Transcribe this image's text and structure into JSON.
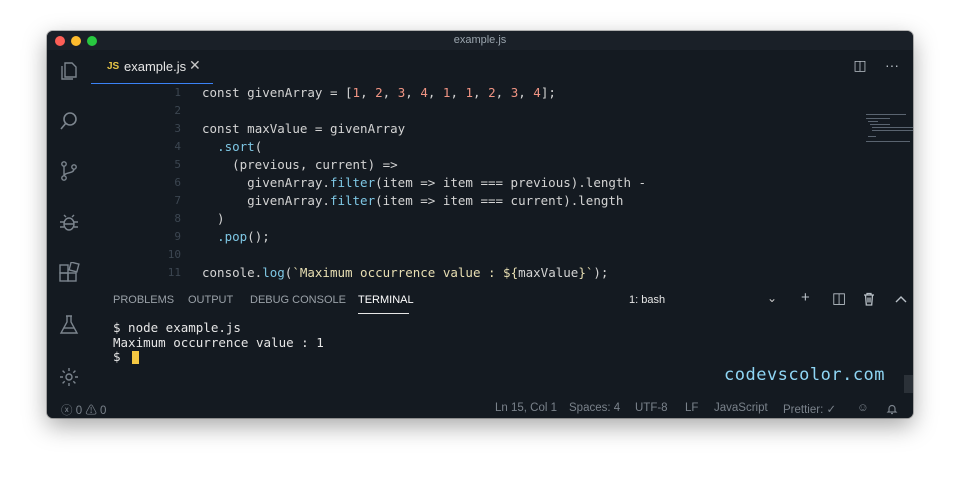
{
  "window": {
    "title": "example.js"
  },
  "tab": {
    "badge": "JS",
    "name": "example.js",
    "close": "✕"
  },
  "tab_actions": {
    "split": "◫",
    "more": "···"
  },
  "editor": {
    "lines": [
      {
        "n": "1",
        "text": "const givenArray = [1, 2, 3, 4, 1, 1, 2, 3, 4];"
      },
      {
        "n": "2",
        "text": ""
      },
      {
        "n": "3",
        "text": "const maxValue = givenArray"
      },
      {
        "n": "4",
        "text": "  .sort("
      },
      {
        "n": "5",
        "text": "    (previous, current) =>"
      },
      {
        "n": "6",
        "text": "      givenArray.filter(item => item === previous).length -"
      },
      {
        "n": "7",
        "text": "      givenArray.filter(item => item === current).length"
      },
      {
        "n": "8",
        "text": "  )"
      },
      {
        "n": "9",
        "text": "  .pop();"
      },
      {
        "n": "10",
        "text": ""
      },
      {
        "n": "11",
        "text": "console.log(`Maximum occurrence value : ${maxValue}`);"
      }
    ]
  },
  "panel": {
    "tabs": [
      "PROBLEMS",
      "OUTPUT",
      "DEBUG CONSOLE",
      "TERMINAL"
    ],
    "active_tab": "TERMINAL",
    "shell": "1: bash",
    "actions": {
      "add": "+",
      "split": "◫",
      "trash": "🗑",
      "maximize": "︿",
      "close": "✕"
    }
  },
  "terminal": {
    "lines": [
      "$ node example.js",
      "Maximum occurrence value : 1",
      "$ "
    ]
  },
  "watermark": "codevscolor.com",
  "statusbar": {
    "errors": "0",
    "warnings": "0",
    "position": "Ln 15, Col 1",
    "spaces": "Spaces: 4",
    "encoding": "UTF-8",
    "eol": "LF",
    "language": "JavaScript",
    "prettier": "Prettier: ✓"
  },
  "colors": {
    "accent": "#3b82f6",
    "cursor": "#f5c842",
    "background": "#141a21",
    "watermark": "#8fd6f5"
  }
}
